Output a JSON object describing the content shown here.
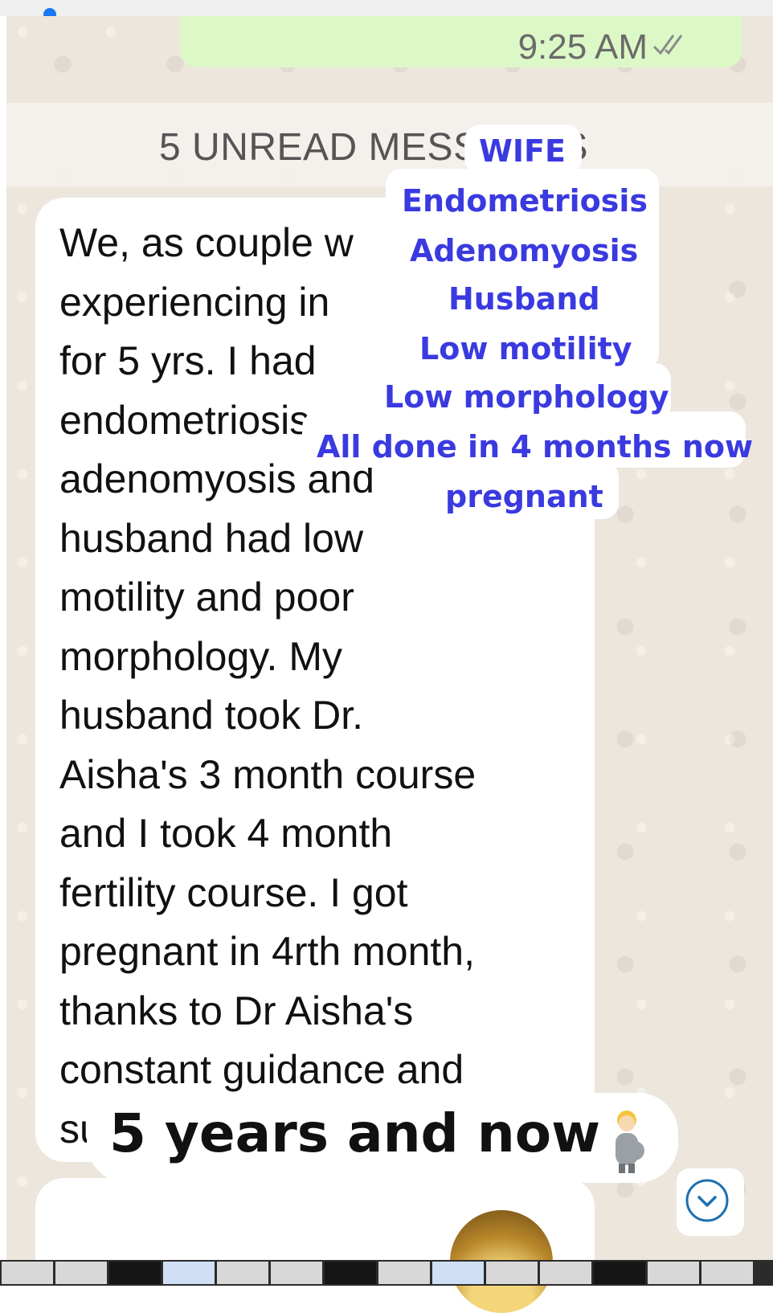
{
  "chat": {
    "sent_time": "9:25 AM",
    "unread_banner": "5 UNREAD MESSAGES",
    "message_text": "We, as couple w\nexperiencing in\nfor 5 yrs. I had\nendometriosis\nadenomyosis and\nhusband had low\nmotility and poor\nmorphology. My\nhusband took Dr.\nAisha's 3 month course\nand I took 4 month\nfertility course. I got\npregnant in 4rth month,\nthanks to Dr Aisha's\nconstant guidance and\nsu"
  },
  "overlay": {
    "lines": [
      "WIFE",
      "Endometriosis",
      "Adenomyosis",
      "Husband",
      "Low motility",
      "Low morphology",
      "All done in 4 months now",
      "pregnant"
    ],
    "color": "#3a3ae0"
  },
  "bottom_caption": "5 years and now",
  "icons": {
    "read_receipt": "double-check-icon",
    "emoji": "pregnant-person-emoji-icon",
    "scroll": "chevron-down-circle-icon"
  },
  "colors": {
    "sent_bubble": "#dcf8c6",
    "chat_background": "#ece6dd"
  }
}
